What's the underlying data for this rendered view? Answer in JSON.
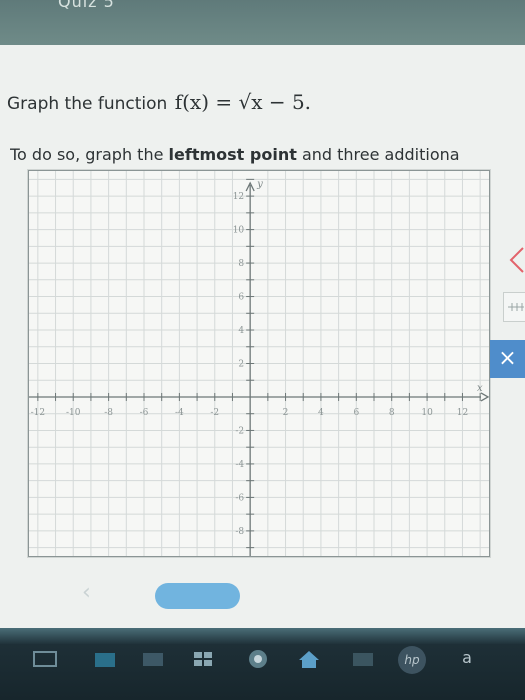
{
  "header": {
    "title": "Quiz 5"
  },
  "question": {
    "prefix": "Graph the function ",
    "formula": "f(x) = √x − 5."
  },
  "instruction": {
    "part1": "To do so, graph the ",
    "bold": "leftmost point",
    "part2": " and three additiona"
  },
  "graph": {
    "x_ticks": [
      "-12",
      "-10",
      "-8",
      "-6",
      "-4",
      "-2",
      "2",
      "4",
      "6",
      "8",
      "10",
      "12"
    ],
    "y_ticks": [
      "12",
      "10",
      "8",
      "6",
      "4",
      "2",
      "-2",
      "-4",
      "-6",
      "-8"
    ],
    "x_axis_label": "x",
    "y_axis_label": "y",
    "x_range": [
      -12.5,
      13.5
    ],
    "y_range": [
      -9.5,
      13.5
    ]
  },
  "controls": {
    "close_label": "×"
  },
  "taskbar": {
    "icons": [
      "task-view-icon",
      "store-icon",
      "mail-icon",
      "windows-store-icon",
      "chrome-icon",
      "home-icon",
      "photos-icon",
      "hp-icon",
      "amazon-icon"
    ],
    "hp_label": "hp",
    "amazon_label": "a"
  }
}
